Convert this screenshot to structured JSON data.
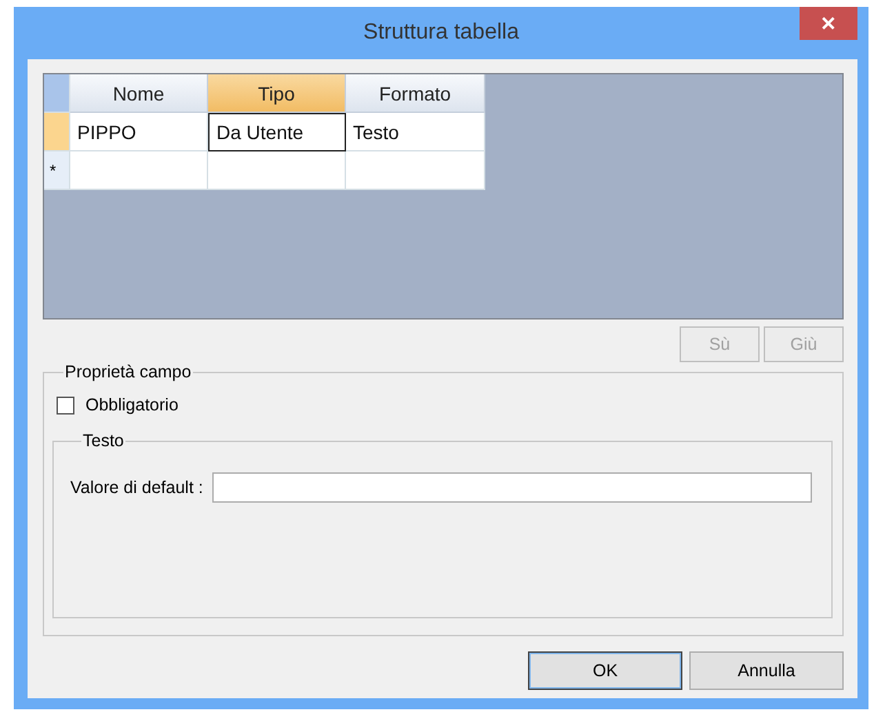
{
  "window": {
    "title": "Struttura tabella",
    "close": "✕"
  },
  "grid": {
    "columns": [
      {
        "label": "Nome",
        "selected": false
      },
      {
        "label": "Tipo",
        "selected": true
      },
      {
        "label": "Formato",
        "selected": false
      }
    ],
    "rows": [
      {
        "kind": "data",
        "selected": true,
        "cells": [
          {
            "text": "PIPPO",
            "focused": false
          },
          {
            "text": "Da Utente",
            "focused": true
          },
          {
            "text": "Testo",
            "focused": false
          }
        ]
      },
      {
        "kind": "new",
        "marker": "*",
        "selected": false,
        "cells": [
          {
            "focused": false
          },
          {
            "focused": false
          },
          {
            "focused": false
          }
        ]
      }
    ]
  },
  "move_buttons": [
    {
      "label": "Sù",
      "disabled": true
    },
    {
      "label": "Giù",
      "disabled": true
    }
  ],
  "field_properties": {
    "legend": "Proprietà campo",
    "required": {
      "label": "Obbligatorio",
      "checked": false
    },
    "type_group": {
      "legend": "Testo",
      "default_label": "Valore di default :"
    }
  },
  "buttons": [
    {
      "label": "OK",
      "default": true
    },
    {
      "label": "Annulla",
      "default": false
    }
  ]
}
